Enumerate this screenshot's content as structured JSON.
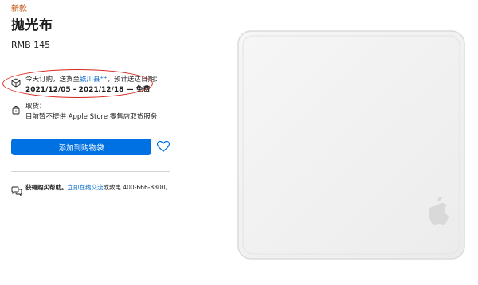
{
  "product": {
    "badge": "新款",
    "title": "抛光布",
    "price": "RMB 145"
  },
  "delivery": {
    "icon": "box-icon",
    "prefix": "今天订购，送货至",
    "location_link": "铁川县",
    "location_suffix": "⁺⁺",
    "suffix": "，预计送达日期：",
    "dates": "2021/12/05 - 2021/12/18 — 免费",
    "highlight_color": "#d9261c"
  },
  "pickup": {
    "icon": "store-bag-icon",
    "label": "取货：",
    "note": "目前暂不提供 Apple Store 零售店取货服务"
  },
  "actions": {
    "add_to_bag": "添加到购物袋",
    "add_to_bag_color": "#0071e3",
    "wishlist_icon": "heart-icon"
  },
  "help": {
    "icon": "chat-bubbles-icon",
    "lead": "获得购买帮助。",
    "link": "立即在线交流",
    "tail": "或致电 400-666-8800。"
  }
}
